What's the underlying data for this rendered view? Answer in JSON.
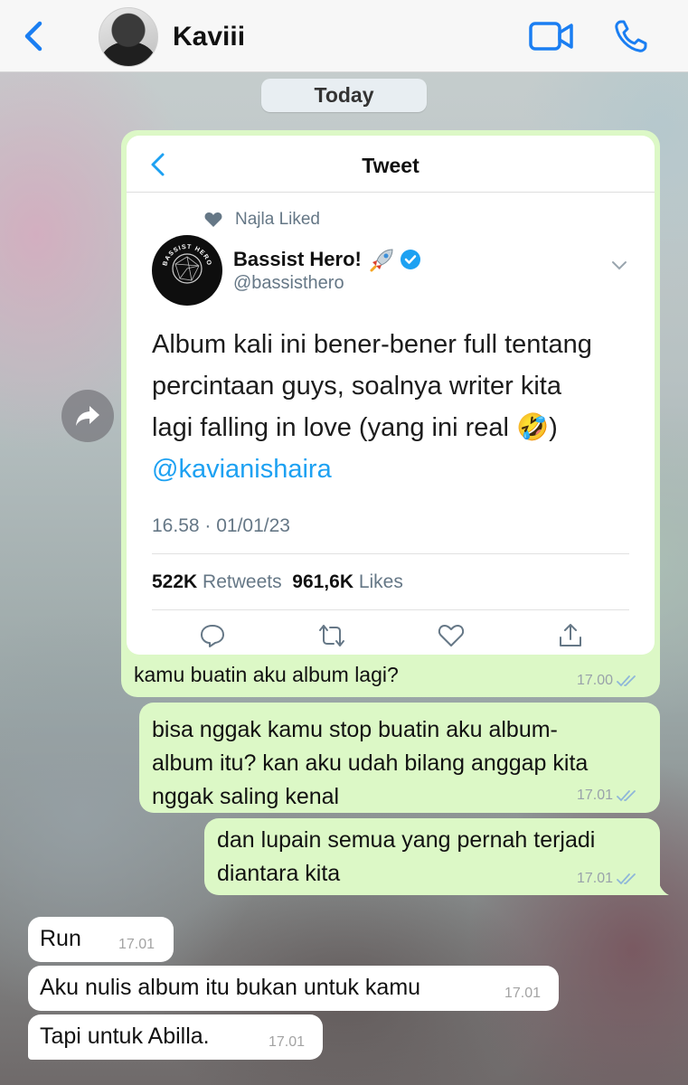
{
  "header": {
    "contact_name": "Kaviii"
  },
  "date_pill": "Today",
  "tweet": {
    "topbar_title": "Tweet",
    "liked_by": "Najla Liked",
    "display_name": "Bassist Hero!",
    "handle": "@bassisthero",
    "logo_text": "BASSIST HERO",
    "body_lines": [
      "Album kali ini bener-bener full tentang",
      "percintaan guys, soalnya writer kita",
      "lagi falling in love (yang ini real 🤣)"
    ],
    "mention": "@kavianishaira",
    "timestamp": "16.58 · 01/01/23",
    "retweets_count": "522K",
    "retweets_label": "Retweets",
    "likes_count": "961,6K",
    "likes_label": "Likes",
    "action_icons": [
      "reply-icon",
      "retweet-icon",
      "like-icon",
      "share-icon"
    ]
  },
  "messages": {
    "out_1": {
      "text": "kamu buatin aku album lagi?",
      "time": "17.00"
    },
    "out_2": {
      "lines": [
        "bisa nggak kamu stop buatin aku album-",
        "album itu? kan aku udah bilang anggap kita",
        "nggak saling kenal"
      ],
      "time": "17.01"
    },
    "out_3": {
      "lines": [
        "dan lupain semua yang pernah terjadi",
        "diantara kita"
      ],
      "time": "17.01"
    },
    "in_1": {
      "text": "Run",
      "time": "17.01"
    },
    "in_2": {
      "text": "Aku nulis album itu bukan untuk kamu",
      "time": "17.01"
    },
    "in_3": {
      "text": "Tapi untuk Abilla.",
      "time": "17.01"
    }
  },
  "colors": {
    "accent_blue": "#1a7ef2",
    "outgoing_bubble": "#dcf8c6",
    "incoming_bubble": "#ffffff",
    "twitter_blue": "#1da1f2"
  }
}
